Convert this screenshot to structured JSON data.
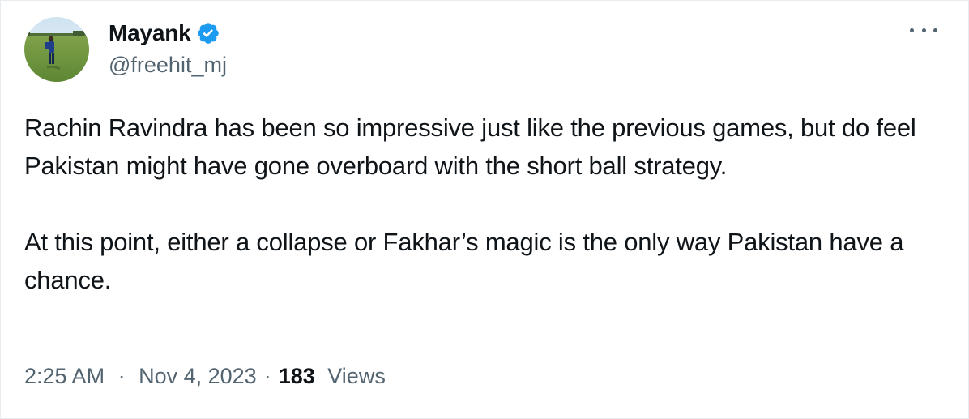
{
  "author": {
    "display_name": "Mayank",
    "handle": "@freehit_mj",
    "verified": true,
    "verified_color": "#1d9bf0"
  },
  "tweet": {
    "paragraph_1": "Rachin Ravindra has been so impressive just like the previous games, but do feel Pakistan might have gone overboard with the short ball strategy.",
    "paragraph_2": "At this point, either a collapse or Fakhar’s magic is the only way Pakistan have a chance."
  },
  "meta": {
    "time": "2:25 AM",
    "separator": "·",
    "date": "Nov 4, 2023",
    "views_count": "183",
    "views_label": "Views"
  },
  "icons": {
    "more": "more-options-icon",
    "verified": "verified-badge-icon"
  },
  "colors": {
    "text_primary": "#0f1419",
    "text_secondary": "#536471",
    "accent": "#1d9bf0"
  }
}
